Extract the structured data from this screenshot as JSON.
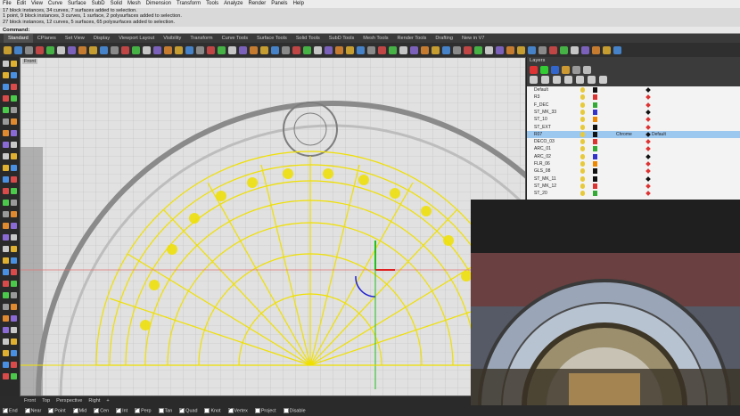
{
  "menu": [
    "File",
    "Edit",
    "View",
    "Curve",
    "Surface",
    "SubD",
    "Solid",
    "Mesh",
    "Dimension",
    "Transform",
    "Tools",
    "Analyze",
    "Render",
    "Panels",
    "Help"
  ],
  "history": [
    "17 block instances, 34 curves, 7 surfaces added to selection.",
    "1 point, 9 block instances, 3 curves, 1 surface, 2 polysurfaces added to selection.",
    "27 block instances, 12 curves, 5 surfaces, 65 polysurfaces added to selection."
  ],
  "command_label": "Command:",
  "tabs": [
    "Standard",
    "CPlanes",
    "Set View",
    "Display",
    "Viewport Layout",
    "Visibility",
    "Transform",
    "Curve Tools",
    "Surface Tools",
    "Solid Tools",
    "SubD Tools",
    "Mesh Tools",
    "Render Tools",
    "Drafting",
    "New in V7"
  ],
  "active_tab": "Standard",
  "viewport_label": "Front",
  "viewport_tabs": [
    "Front",
    "Top",
    "Perspective",
    "Right",
    "+"
  ],
  "layers_title": "Layers",
  "layers": [
    {
      "name": "Default",
      "sel": false
    },
    {
      "name": "R3",
      "sel": false
    },
    {
      "name": "F_DEC",
      "sel": false
    },
    {
      "name": "ST_MK_33",
      "sel": false
    },
    {
      "name": "ST_10",
      "sel": false
    },
    {
      "name": "ST_EXT",
      "sel": false
    },
    {
      "name": "R07",
      "sel": true,
      "material": "Chrome",
      "print": "Default"
    },
    {
      "name": "DECO_03",
      "sel": false
    },
    {
      "name": "ARC_01",
      "sel": false
    },
    {
      "name": "ARC_02",
      "sel": false
    },
    {
      "name": "FLR_06",
      "sel": false
    },
    {
      "name": "GLS_08",
      "sel": false
    },
    {
      "name": "ST_MK_11",
      "sel": false
    },
    {
      "name": "ST_MK_12",
      "sel": false
    },
    {
      "name": "ST_20",
      "sel": false
    }
  ],
  "osnaps": [
    {
      "label": "End",
      "on": true
    },
    {
      "label": "Near",
      "on": true
    },
    {
      "label": "Point",
      "on": true
    },
    {
      "label": "Mid",
      "on": true
    },
    {
      "label": "Cen",
      "on": true
    },
    {
      "label": "Int",
      "on": true
    },
    {
      "label": "Perp",
      "on": true
    },
    {
      "label": "Tan",
      "on": false
    },
    {
      "label": "Quad",
      "on": true
    },
    {
      "label": "Knot",
      "on": false
    },
    {
      "label": "Vertex",
      "on": true
    },
    {
      "label": "Project",
      "on": false
    },
    {
      "label": "Disable",
      "on": false
    }
  ],
  "colors": {
    "selection": "#f0e000",
    "layer_selected": "#9cc7ef",
    "gumball_x": "#e02020",
    "gumball_y": "#20c020",
    "gumball_z": "#2020d0"
  }
}
